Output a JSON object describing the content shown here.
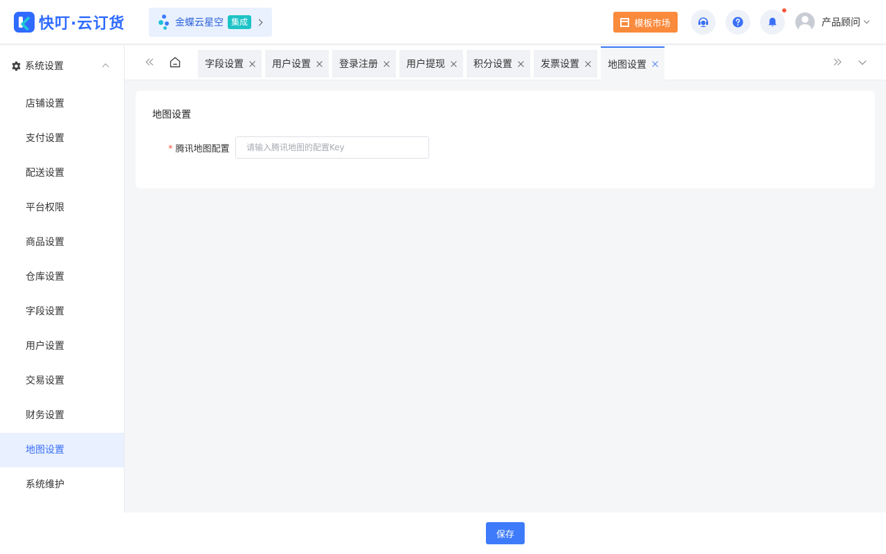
{
  "header": {
    "logo_text": "快叮·云订货",
    "kingdee": {
      "name": "金蝶云星空",
      "badge": "集成"
    },
    "template_market": "模板市场",
    "user_name": "产品顾问",
    "colors": {
      "brand": "#2f6bff",
      "template_button": "#fa8a3c",
      "notification_dot": "#f5563b"
    }
  },
  "sidebar": {
    "group_label": "系统设置",
    "items": [
      {
        "label": "店铺设置"
      },
      {
        "label": "支付设置"
      },
      {
        "label": "配送设置"
      },
      {
        "label": "平台权限"
      },
      {
        "label": "商品设置"
      },
      {
        "label": "仓库设置"
      },
      {
        "label": "字段设置"
      },
      {
        "label": "用户设置"
      },
      {
        "label": "交易设置"
      },
      {
        "label": "财务设置"
      },
      {
        "label": "地图设置",
        "active": true
      },
      {
        "label": "系统维护"
      }
    ]
  },
  "tabs": [
    {
      "label": "字段设置"
    },
    {
      "label": "用户设置"
    },
    {
      "label": "登录注册"
    },
    {
      "label": "用户提现"
    },
    {
      "label": "积分设置"
    },
    {
      "label": "发票设置"
    },
    {
      "label": "地图设置",
      "active": true
    }
  ],
  "main": {
    "card_title": "地图设置",
    "field_label": "腾讯地图配置",
    "field_required": "*",
    "field_placeholder": "请输入腾讯地图的配置Key",
    "field_value": ""
  },
  "footer": {
    "save_label": "保存"
  },
  "icons": {
    "gear": "gear-icon",
    "home": "home-icon",
    "service": "customer-service-icon",
    "help": "help-icon",
    "bell": "bell-icon",
    "chevron": "chevron-icon",
    "close": "close-icon"
  }
}
